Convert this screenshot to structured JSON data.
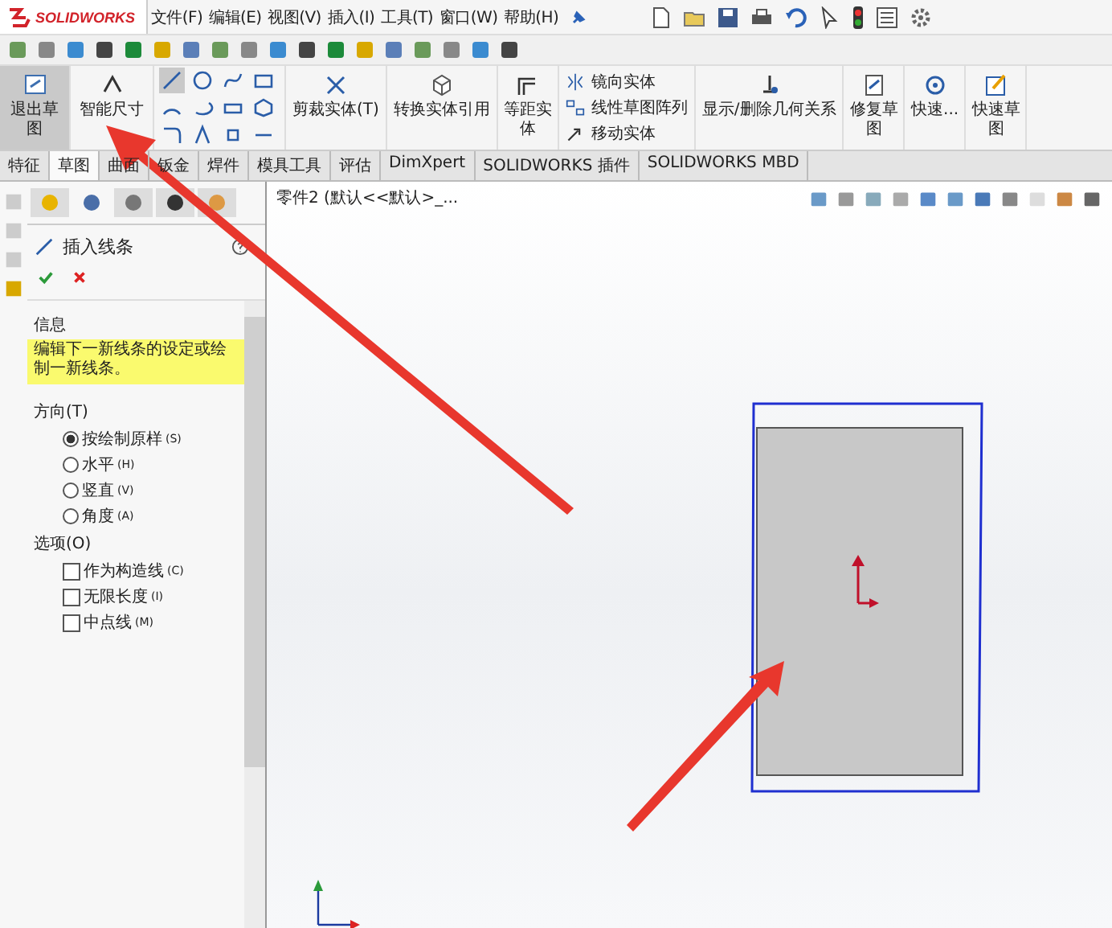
{
  "app": {
    "logo": "SOLIDWORKS"
  },
  "menu": [
    "文件(F)",
    "编辑(E)",
    "视图(V)",
    "插入(I)",
    "工具(T)",
    "窗口(W)",
    "帮助(H)"
  ],
  "commands": {
    "exit_sketch": {
      "label": "退出草图",
      "selected": true
    },
    "smart_dimension": {
      "label": "智能尺寸"
    },
    "trim": "剪裁实体(T)",
    "convert": "转换实体引用",
    "offset": "等距实体",
    "mirror": "镜向实体",
    "pattern": "线性草图阵列",
    "move": "移动实体",
    "relations": "显示/删除几何关系",
    "repair": "修复草图",
    "quick_snaps": "快速...",
    "rapid_sketch": "快速草图"
  },
  "tabs": [
    {
      "label": "特征",
      "selected": false
    },
    {
      "label": "草图",
      "selected": true
    },
    {
      "label": "曲面",
      "selected": false
    },
    {
      "label": "钣金",
      "selected": false
    },
    {
      "label": "焊件",
      "selected": false
    },
    {
      "label": "模具工具",
      "selected": false
    },
    {
      "label": "评估",
      "selected": false
    },
    {
      "label": "DimXpert",
      "selected": false
    },
    {
      "label": "SOLIDWORKS 插件",
      "selected": false
    },
    {
      "label": "SOLIDWORKS MBD",
      "selected": false
    }
  ],
  "panel": {
    "title": "插入线条",
    "info_heading": "信息",
    "info_text": "编辑下一新线条的设定或绘制一新线条。",
    "direction_heading": "方向(T)",
    "directions": [
      {
        "label": "按绘制原样",
        "key": "(S)",
        "selected": true
      },
      {
        "label": "水平",
        "key": "(H)",
        "selected": false
      },
      {
        "label": "竖直",
        "key": "(V)",
        "selected": false
      },
      {
        "label": "角度",
        "key": "(A)",
        "selected": false
      }
    ],
    "options_heading": "选项(O)",
    "options": [
      {
        "label": "作为构造线",
        "key": "(C)",
        "checked": false
      },
      {
        "label": "无限长度",
        "key": "(I)",
        "checked": false
      },
      {
        "label": "中点线",
        "key": "(M)",
        "checked": false
      }
    ]
  },
  "tree": {
    "text": "零件2  (默认<<默认>_..."
  }
}
